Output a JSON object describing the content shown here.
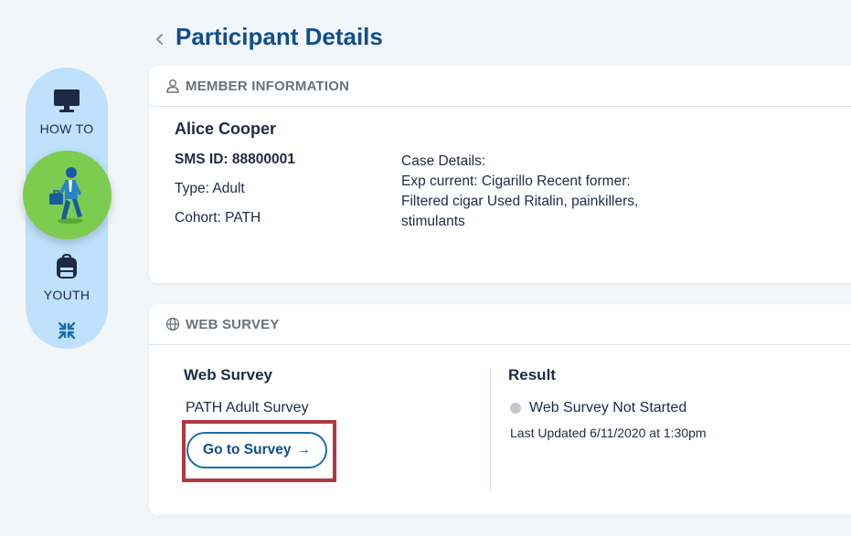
{
  "header": {
    "title": "Participant Details"
  },
  "sidebar": {
    "howto_label": "HOW TO",
    "youth_label": "YOUTH"
  },
  "member": {
    "section_title": "MEMBER INFORMATION",
    "name": "Alice Cooper",
    "sms_id": "SMS ID: 88800001",
    "type": "Type: Adult",
    "cohort": "Cohort: PATH",
    "case_details_label": "Case Details:",
    "case_details_text": "Exp current: Cigarillo Recent former: Filtered cigar Used Ritalin, painkillers, stimulants"
  },
  "survey": {
    "section_title": "WEB SURVEY",
    "column_title": "Web Survey",
    "survey_name": "PATH Adult Survey",
    "button_label": "Go to Survey",
    "result_title": "Result",
    "status": "Web Survey Not Started",
    "last_updated": "Last Updated 6/11/2020 at 1:30pm"
  },
  "colors": {
    "title_blue": "#0e4e8e",
    "sidebar_bg": "#bfe1fb",
    "active_green": "#7ccc4f",
    "highlight_red": "#b0383f",
    "status_gray": "#c4c7cb"
  }
}
